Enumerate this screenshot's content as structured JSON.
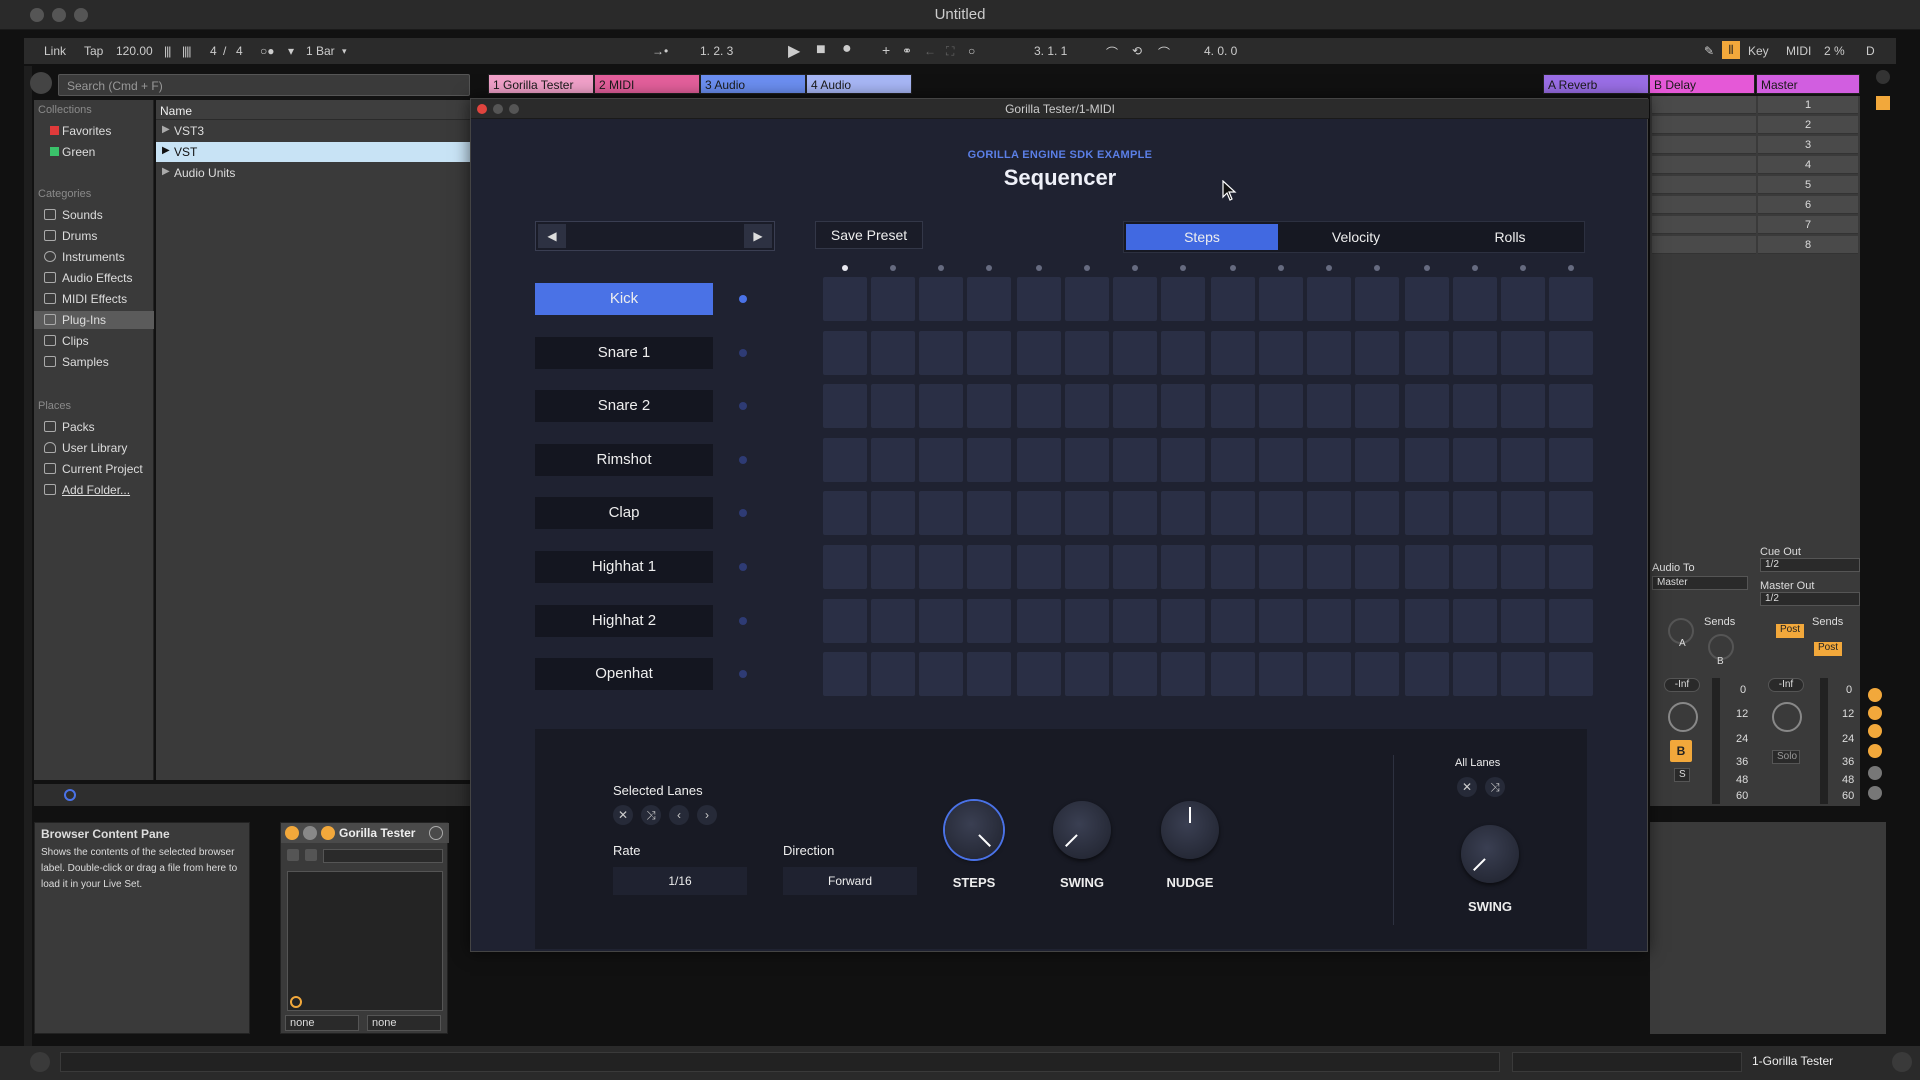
{
  "window": {
    "title": "Untitled"
  },
  "transport": {
    "link": "Link",
    "tap": "Tap",
    "tempo": "120.00",
    "signature_num": "4",
    "signature_sep": "/",
    "signature_den": "4",
    "quantize": "1 Bar",
    "arrangement_position": "1.  2.  3",
    "loop_start": "3.  1.  1",
    "loop_length": "4.  0.  0",
    "key": "Key",
    "midi": "MIDI",
    "cpu": "2 %",
    "disk": "D"
  },
  "browser": {
    "search_placeholder": "Search (Cmd + F)",
    "collections_header": "Collections",
    "collections": [
      {
        "label": "Favorites",
        "color": "#e03a3a"
      },
      {
        "label": "Green",
        "color": "#3ac26a"
      }
    ],
    "categories_header": "Categories",
    "categories": [
      "Sounds",
      "Drums",
      "Instruments",
      "Audio Effects",
      "MIDI Effects",
      "Plug-Ins",
      "Clips",
      "Samples"
    ],
    "selected_category": "Plug-Ins",
    "places_header": "Places",
    "places": [
      "Packs",
      "User Library",
      "Current Project",
      "Add Folder..."
    ],
    "name_header": "Name",
    "files": [
      "VST3",
      "VST",
      "Audio Units"
    ],
    "selected_file": "VST"
  },
  "info_pane": {
    "title": "Browser Content Pane",
    "text": "Shows the contents of the selected browser label. Double-click or drag a file from here to load it in your Live Set."
  },
  "device": {
    "name": "Gorilla Tester",
    "select_left": "none",
    "select_right": "none"
  },
  "tracks": [
    {
      "label": "1 Gorilla Tester",
      "color": "#f0a0c8"
    },
    {
      "label": "2 MIDI",
      "color": "#e35f9b"
    },
    {
      "label": "3 Audio",
      "color": "#6b8ef0"
    },
    {
      "label": "4 Audio",
      "color": "#a7b6f5"
    },
    {
      "label": "A Reverb",
      "color": "#9a6ee6"
    },
    {
      "label": "B Delay",
      "color": "#e558d7"
    },
    {
      "label": "Master",
      "color": "#d15ee0"
    }
  ],
  "scenes": [
    "1",
    "2",
    "3",
    "4",
    "5",
    "6",
    "7",
    "8"
  ],
  "mixer": {
    "audio_to": "Audio To",
    "audio_to_value": "Master",
    "cue_out": "Cue Out",
    "cue_out_value": "1/2",
    "master_out": "Master Out",
    "master_out_value": "1/2",
    "sends": "Sends",
    "send_a": "A",
    "send_b": "B",
    "post": "Post",
    "inf_label": "-Inf",
    "meter_scale": [
      "0",
      "12",
      "24",
      "36",
      "48",
      "60"
    ],
    "track_badge": "B",
    "solo_short": "S",
    "solo": "Solo"
  },
  "status": {
    "track": "1-Gorilla Tester"
  },
  "plugin": {
    "window_title": "Gorilla Tester/1-MIDI",
    "sdk_label": "GORILLA ENGINE SDK EXAMPLE",
    "title": "Sequencer",
    "preset_name": "",
    "save_preset": "Save Preset",
    "tabs": [
      "Steps",
      "Velocity",
      "Rolls"
    ],
    "active_tab": "Steps",
    "steps": 16,
    "playhead_step": 1,
    "lanes": [
      {
        "name": "Kick",
        "selected": true
      },
      {
        "name": "Snare 1",
        "selected": false
      },
      {
        "name": "Snare 2",
        "selected": false
      },
      {
        "name": "Rimshot",
        "selected": false
      },
      {
        "name": "Clap",
        "selected": false
      },
      {
        "name": "Highhat 1",
        "selected": false
      },
      {
        "name": "Highhat 2",
        "selected": false
      },
      {
        "name": "Openhat",
        "selected": false
      }
    ],
    "controls": {
      "selected_lanes": "Selected Lanes",
      "all_lanes": "All Lanes",
      "rate_label": "Rate",
      "rate_value": "1/16",
      "direction_label": "Direction",
      "direction_value": "Forward",
      "knob_steps": "STEPS",
      "knob_swing": "SWING",
      "knob_nudge": "NUDGE",
      "knob_all_swing": "SWING"
    }
  }
}
